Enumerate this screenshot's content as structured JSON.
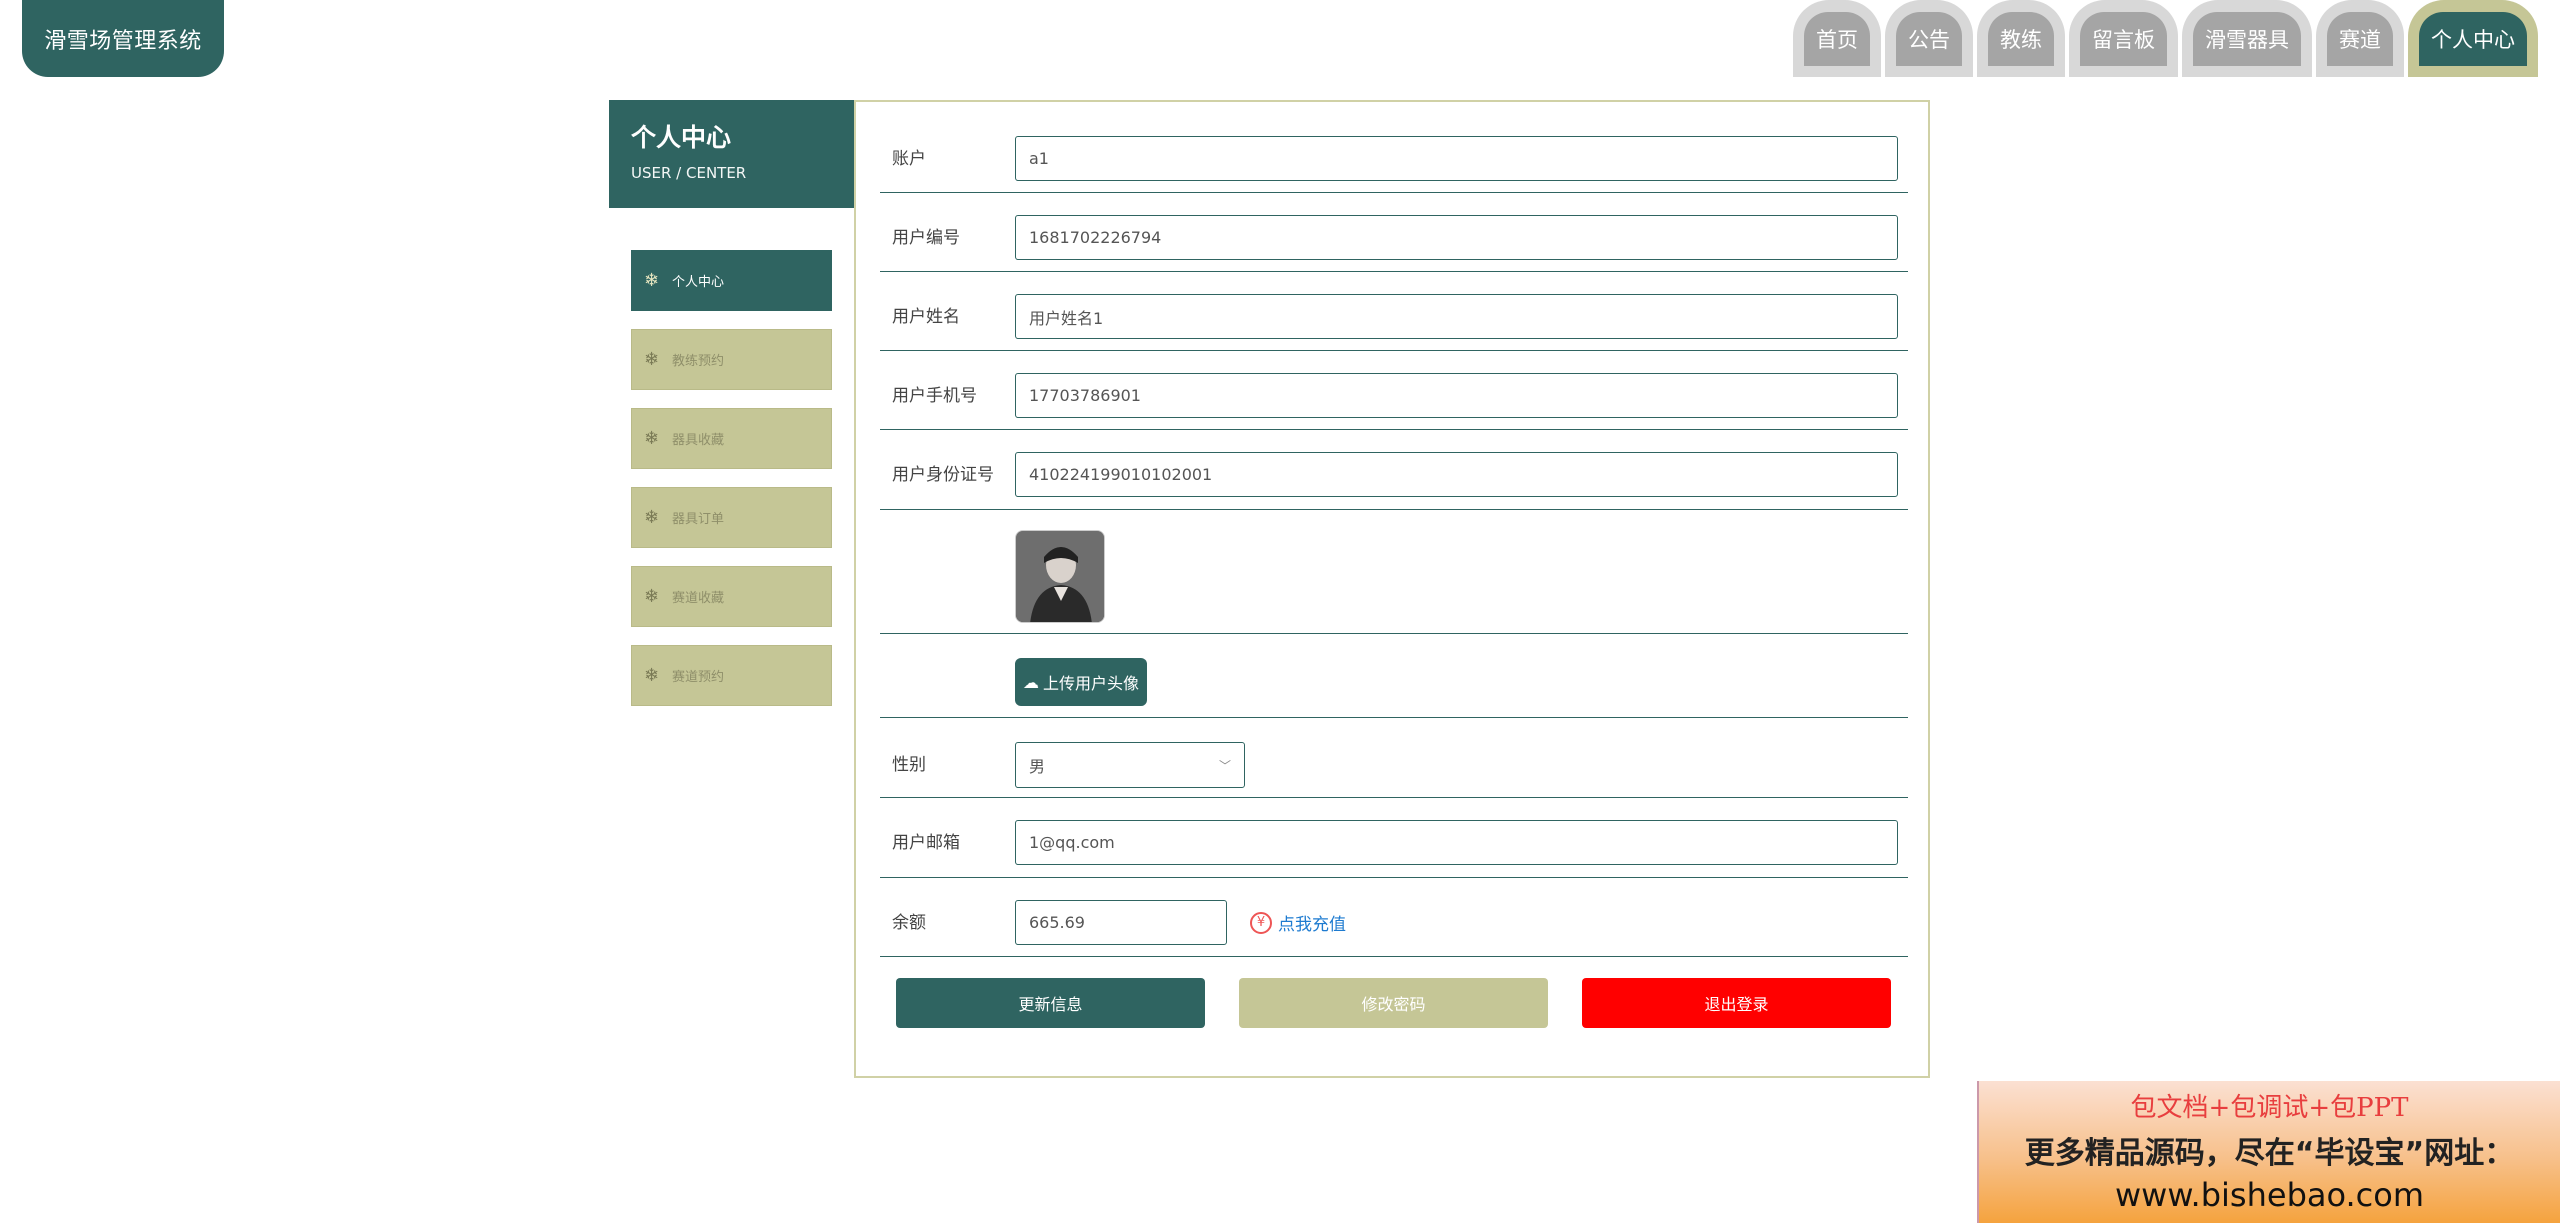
{
  "brand": {
    "title": "滑雪场管理系统"
  },
  "nav": {
    "items": [
      {
        "label": "首页"
      },
      {
        "label": "公告"
      },
      {
        "label": "教练"
      },
      {
        "label": "留言板"
      },
      {
        "label": "滑雪器具"
      },
      {
        "label": "赛道"
      },
      {
        "label": "个人中心",
        "active": true
      }
    ]
  },
  "sidebar": {
    "title": "个人中心",
    "subtitle": "USER / CENTER",
    "items": [
      {
        "label": "个人中心",
        "active": true
      },
      {
        "label": "教练预约"
      },
      {
        "label": "器具收藏"
      },
      {
        "label": "器具订单"
      },
      {
        "label": "赛道收藏"
      },
      {
        "label": "赛道预约"
      }
    ]
  },
  "form": {
    "account": {
      "label": "账户",
      "value": "a1"
    },
    "user_no": {
      "label": "用户编号",
      "value": "1681702226794"
    },
    "user_name": {
      "label": "用户姓名",
      "value": "用户姓名1"
    },
    "phone": {
      "label": "用户手机号",
      "value": "17703786901"
    },
    "id_card": {
      "label": "用户身份证号",
      "value": "410224199010102001"
    },
    "upload_avatar": "上传用户头像",
    "gender": {
      "label": "性别",
      "value": "男"
    },
    "email": {
      "label": "用户邮箱",
      "value": "1@qq.com"
    },
    "balance": {
      "label": "余额",
      "value": "665.69",
      "recharge": "点我充值"
    },
    "buttons": {
      "update": "更新信息",
      "change_password": "修改密码",
      "logout": "退出登录"
    }
  },
  "ad": {
    "line1": "包文档+包调试+包PPT",
    "line2": "更多精品源码，尽在“毕设宝”网址：",
    "line3": "www.bishebao.com"
  },
  "colors": {
    "primary": "#2f6461",
    "secondary": "#c5c696",
    "danger": "#ff0000",
    "nav_inactive": "#a5a5a5"
  },
  "icons": {
    "sidebar": "snowflake-icon",
    "upload": "cloud-upload-icon",
    "select": "chevron-down-icon",
    "recharge": "yen-coin-icon"
  }
}
